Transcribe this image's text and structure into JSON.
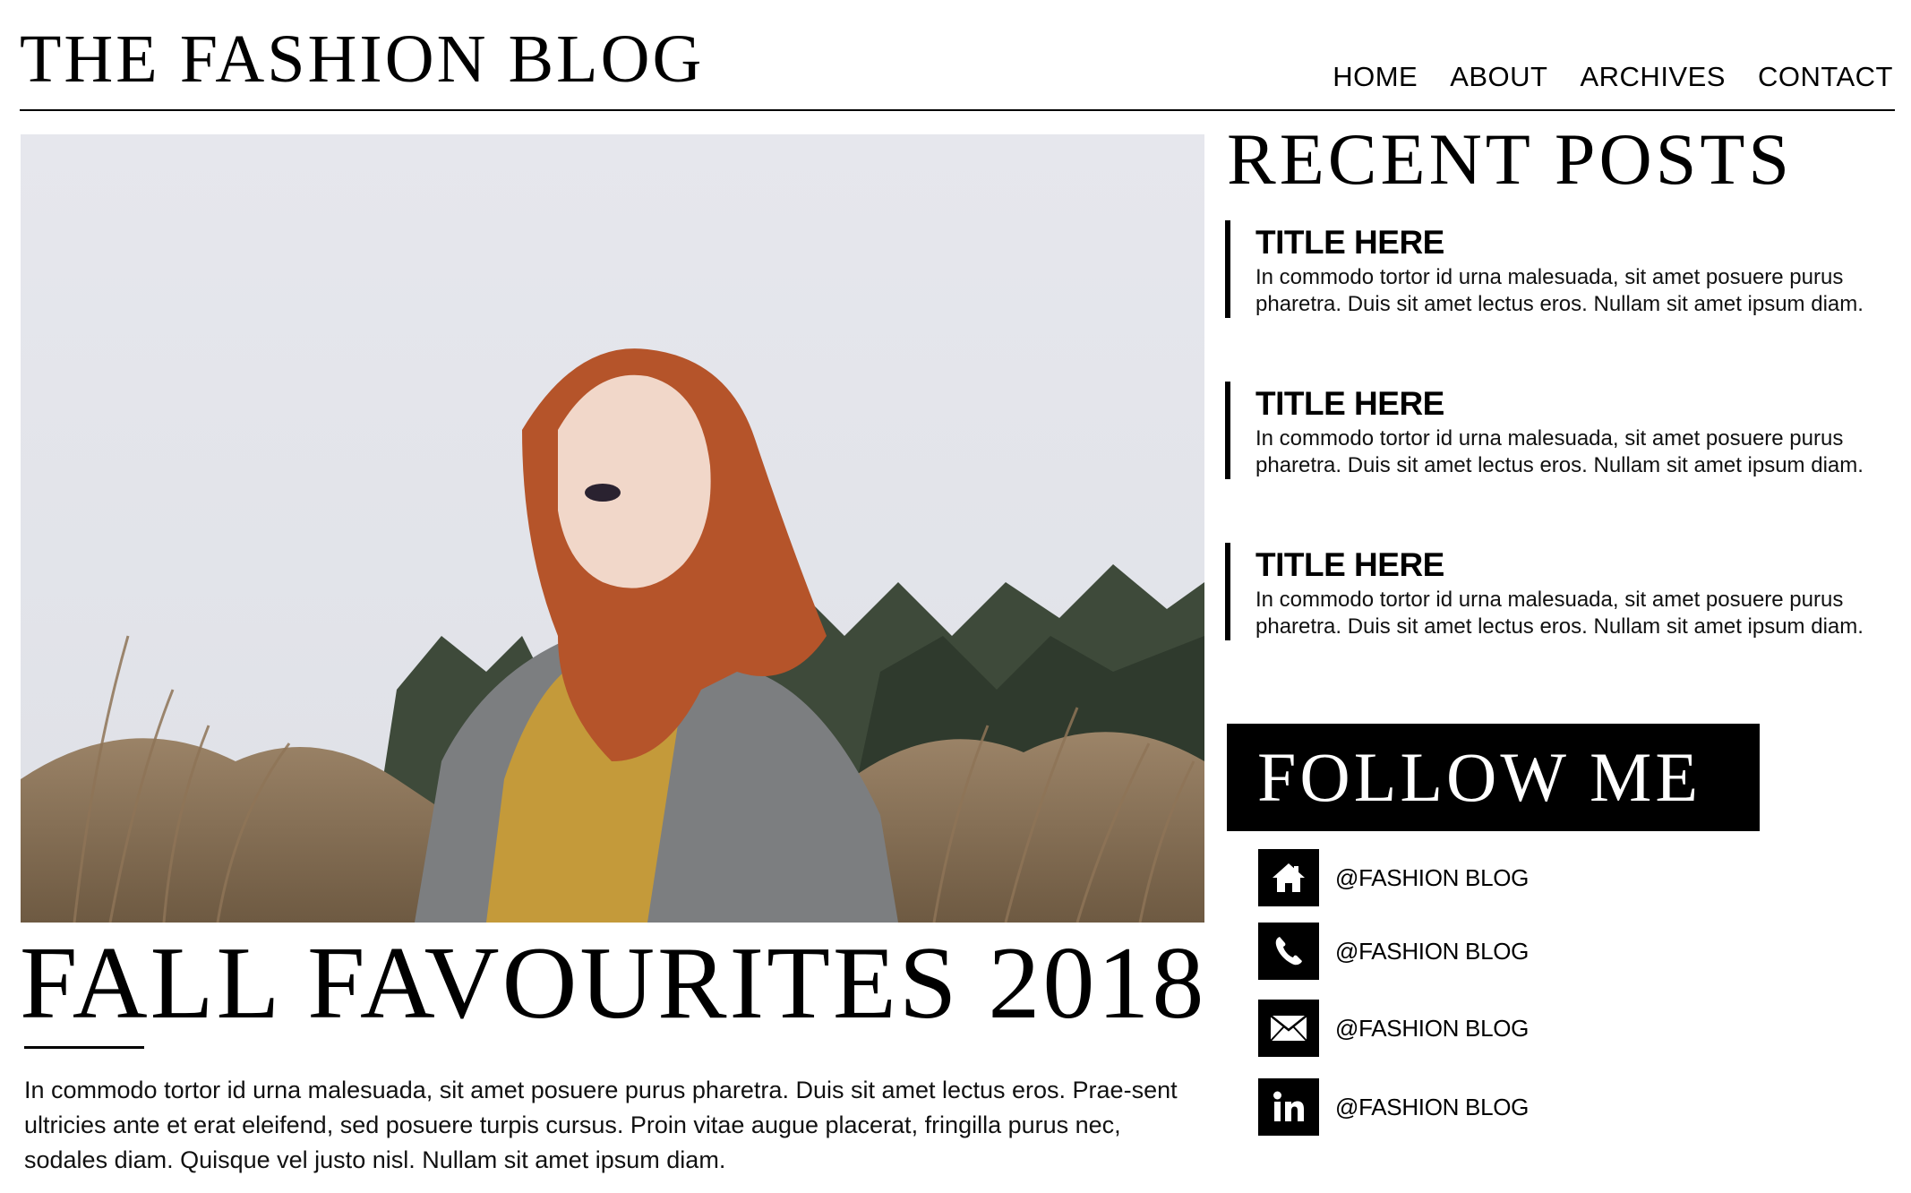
{
  "header": {
    "site_title": "THE FASHION BLOG",
    "nav": [
      {
        "label": "HOME",
        "active": true
      },
      {
        "label": "ABOUT"
      },
      {
        "label": "ARCHIVES"
      },
      {
        "label": "CONTACT"
      }
    ]
  },
  "feature": {
    "title": "FALL FAVOURITES 2018",
    "text": "In commodo tortor id urna malesuada, sit amet posuere purus pharetra. Duis sit amet lectus eros. Prae-sent ultricies ante et erat eleifend, sed posuere turpis cursus. Proin vitae augue placerat, fringilla purus nec, sodales diam. Quisque vel justo nisl. Nullam sit amet ipsum diam."
  },
  "sidebar": {
    "recent_heading": "RECENT POSTS",
    "posts": [
      {
        "title": "TITLE HERE",
        "excerpt": "In commodo tortor id urna malesuada, sit amet posuere purus pharetra. Duis sit amet lectus eros. Nullam sit amet ipsum diam."
      },
      {
        "title": "TITLE HERE",
        "excerpt": "In commodo tortor id urna malesuada, sit amet posuere purus pharetra. Duis sit amet lectus eros. Nullam sit amet ipsum diam."
      },
      {
        "title": "TITLE HERE",
        "excerpt": "In commodo tortor id urna malesuada, sit amet posuere purus pharetra. Duis sit amet lectus eros. Nullam sit amet ipsum diam."
      }
    ],
    "follow_heading": "FOLLOW ME",
    "social": [
      {
        "icon": "home-icon",
        "handle": "@FASHION BLOG"
      },
      {
        "icon": "phone-icon",
        "handle": "@FASHION BLOG"
      },
      {
        "icon": "mail-icon",
        "handle": "@FASHION BLOG"
      },
      {
        "icon": "linkedin-icon",
        "handle": "@FASHION BLOG"
      }
    ]
  },
  "colors": {
    "text": "#000000",
    "background": "#ffffff",
    "accent": "#000000"
  }
}
